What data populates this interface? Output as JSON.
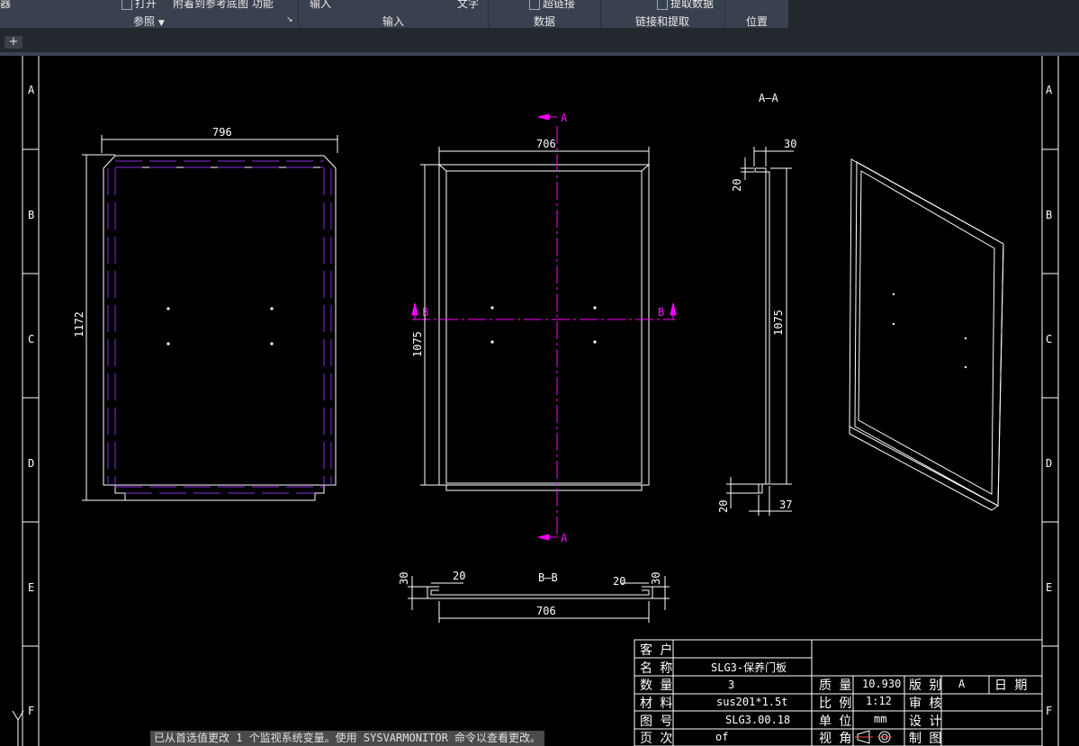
{
  "ribbon": {
    "top_items": {
      "left_cut": "器",
      "open": "打开",
      "attach": "附着到参考底图",
      "attach_tail": "功能",
      "input": "输入",
      "text": "文字",
      "hyperlink": "超链接",
      "extract": "提取数据"
    },
    "panels": {
      "reference": "参照",
      "input": "输入",
      "data": "数据",
      "linking": "链接和提取",
      "location": "位置"
    }
  },
  "tabbar": {
    "new_tab": "+"
  },
  "border_letters": [
    "A",
    "B",
    "C",
    "D",
    "E",
    "F"
  ],
  "views": {
    "section_aa": "A—A",
    "section_bb": "B—B",
    "cut_a": "A",
    "cut_b": "B"
  },
  "dims": {
    "flat_width": "796",
    "flat_height": "1172",
    "front_width": "706",
    "front_height": "1075",
    "side_top": "30",
    "side_left_top": "20",
    "side_height": "1075",
    "side_bottom_left": "20",
    "side_bottom_right": "37",
    "bb_left_30": "30",
    "bb_left_20": "20",
    "bb_right_20": "20",
    "bb_right_30": "30",
    "bb_width": "706"
  },
  "title_block": {
    "customer_label": "客 户",
    "customer_value": "",
    "name_label": "名 称",
    "name_value": "SLG3-保养门板",
    "qty_label": "数 量",
    "qty_value": "3",
    "material_label": "材 料",
    "material_value": "sus201*1.5t",
    "drawing_no_label": "图 号",
    "drawing_no_value": "SLG3.00.18",
    "page_label": "页 次",
    "page_value": "of",
    "mass_label": "质 量",
    "mass_value": "10.930",
    "scale_label": "比 例",
    "scale_value": "1:12",
    "unit_label": "单 位",
    "unit_value": "mm",
    "view_label": "视 角",
    "version_label": "版 别",
    "version_value": "A",
    "review_label": "审 核",
    "design_label": "设 计",
    "drafter_label": "制 图",
    "date_label": "日 期"
  },
  "command_line": "已从首选值更改 1 个监视系统变量。使用 SYSVARMONITOR 命令以查看更改。",
  "colors": {
    "ribbon": "#3a414e",
    "tabbar": "#23272e",
    "canvas": "#000000",
    "line": "#ffffff",
    "hidden_line": "#8a2be2",
    "section_line": "#ff00ff"
  }
}
